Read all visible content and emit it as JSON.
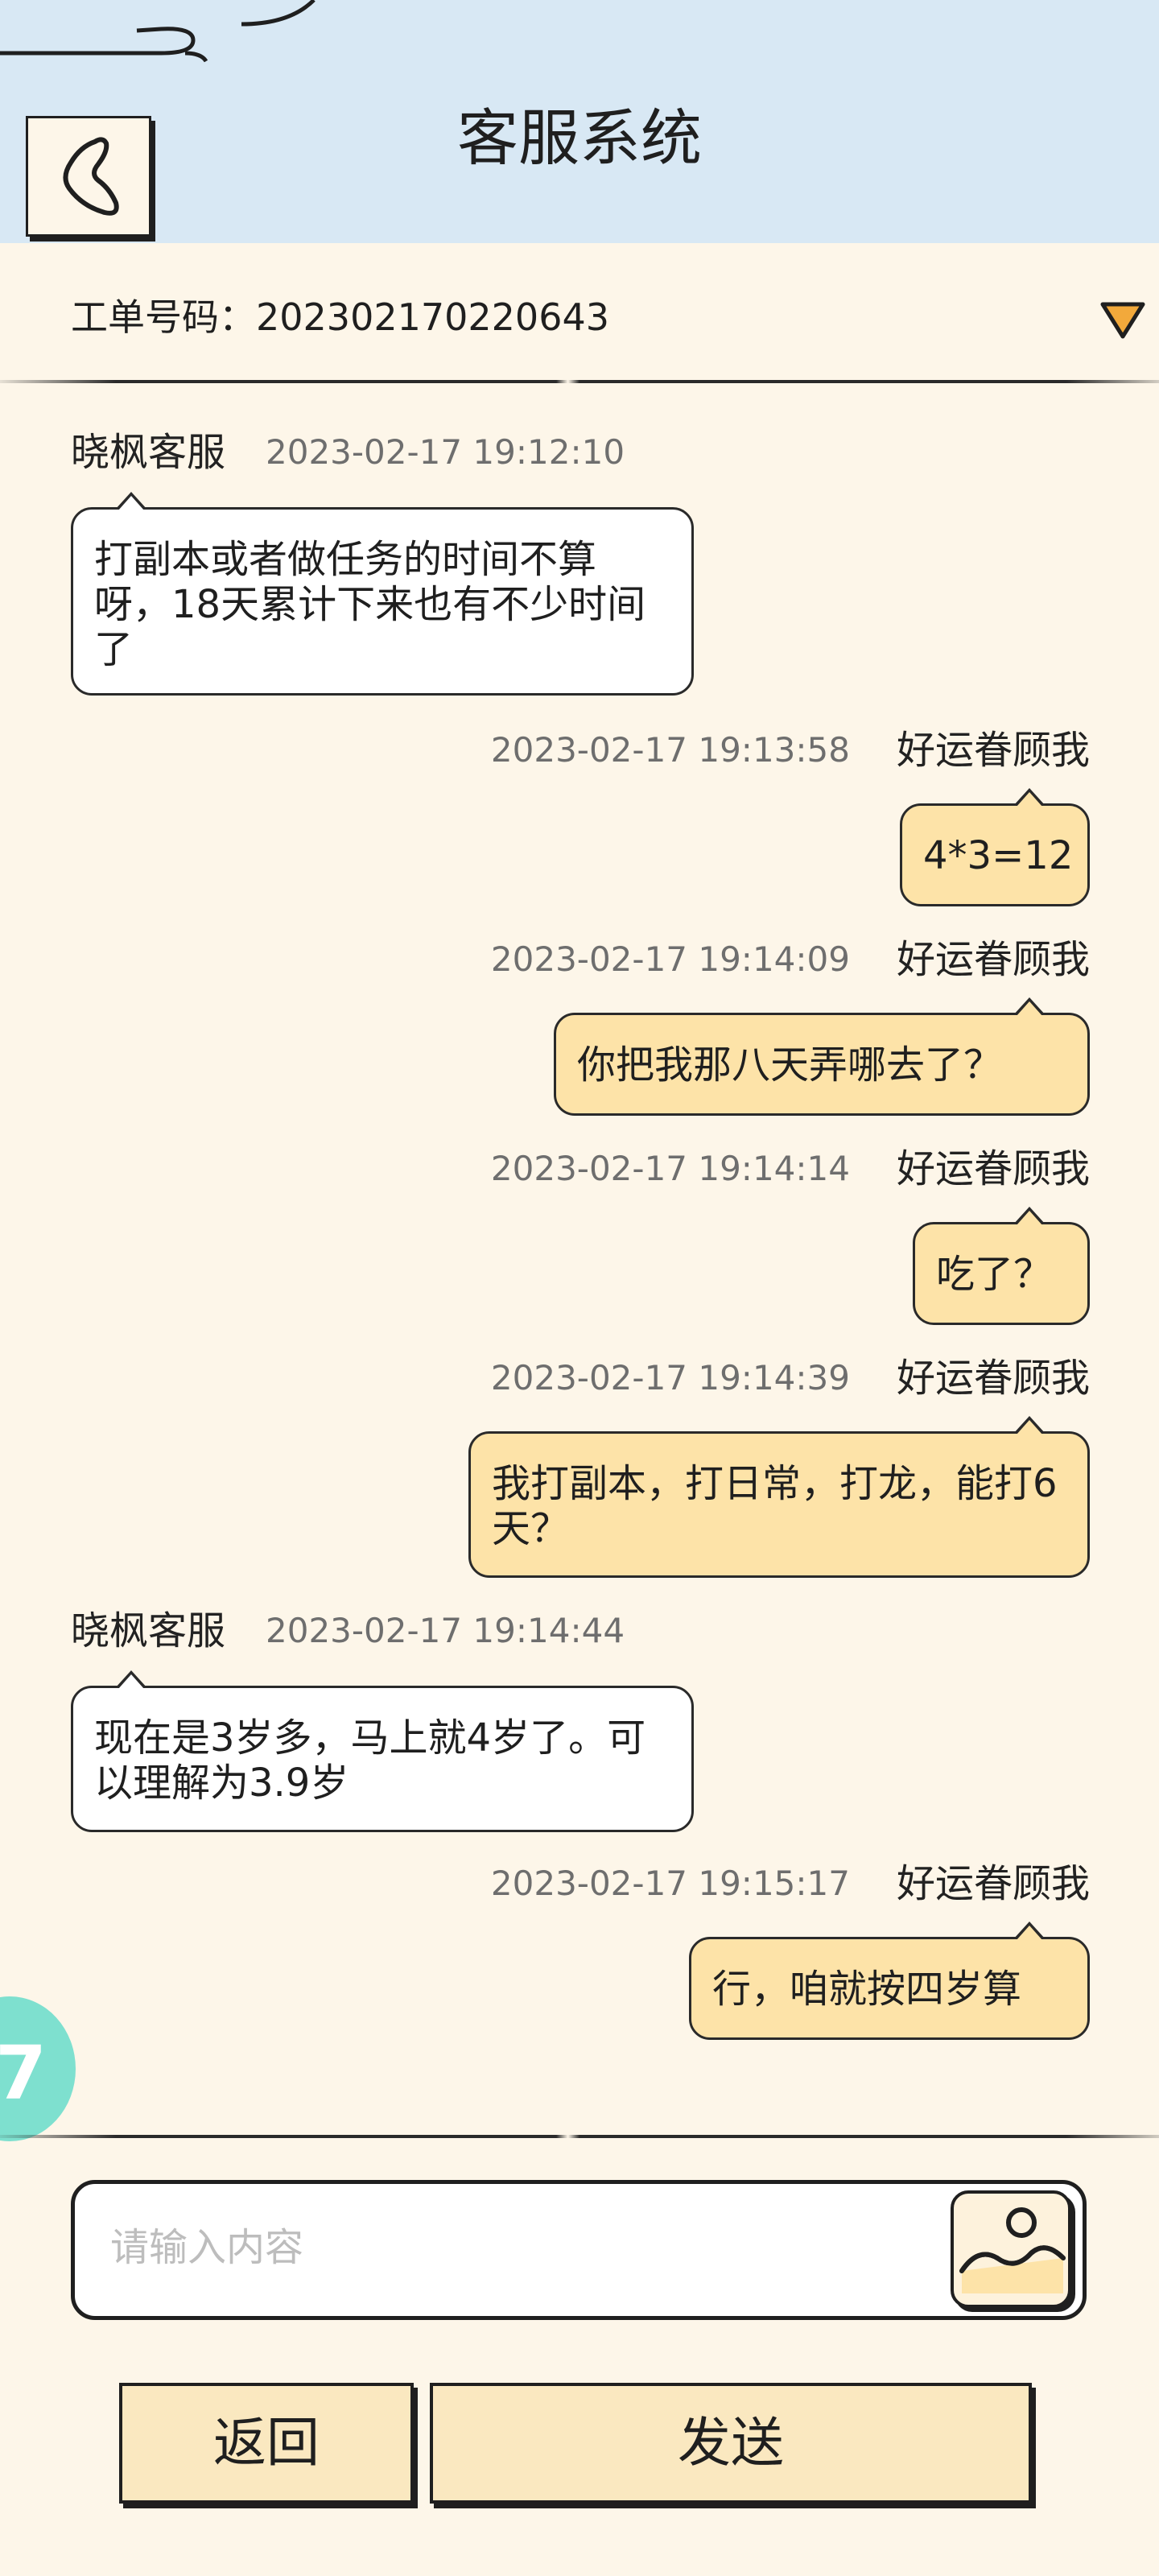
{
  "header": {
    "title": "客服系统",
    "back_icon": "chevron-left-heart-icon"
  },
  "ticket": {
    "label": "工单号码：202302170220643",
    "toggle_icon": "triangle-down-icon"
  },
  "messages": [
    {
      "side": "left",
      "sender": "晓枫客服",
      "time": "2023-02-17 19:12:10",
      "text": "打副本或者做任务的时间不算呀，18天累计下来也有不少时间了"
    },
    {
      "side": "right",
      "sender": "好运眷顾我",
      "time": "2023-02-17 19:13:58",
      "text": "4*3=12"
    },
    {
      "side": "right",
      "sender": "好运眷顾我",
      "time": "2023-02-17 19:14:09",
      "text": "你把我那八天弄哪去了？"
    },
    {
      "side": "right",
      "sender": "好运眷顾我",
      "time": "2023-02-17 19:14:14",
      "text": "吃了？"
    },
    {
      "side": "right",
      "sender": "好运眷顾我",
      "time": "2023-02-17 19:14:39",
      "text": "我打副本，打日常，打龙，能打6天？"
    },
    {
      "side": "left",
      "sender": "晓枫客服",
      "time": "2023-02-17 19:14:44",
      "text": "现在是3岁多，马上就4岁了。可以理解为3.9岁"
    },
    {
      "side": "right",
      "sender": "好运眷顾我",
      "time": "2023-02-17 19:15:17",
      "text": "行，咱就按四岁算"
    }
  ],
  "input": {
    "placeholder": "请输入内容",
    "value": "",
    "image_icon": "image-upload-icon"
  },
  "buttons": {
    "back_label": "返回",
    "send_label": "发送"
  },
  "colors": {
    "header_bg": "#d8e8f4",
    "page_bg": "#fdf6e9",
    "user_bubble": "#fde3a8",
    "agent_bubble": "#ffffff",
    "button_bg": "#fae8c0",
    "ticket_arrow": "#f2a93b",
    "float_helper": "#7ee0cf"
  }
}
